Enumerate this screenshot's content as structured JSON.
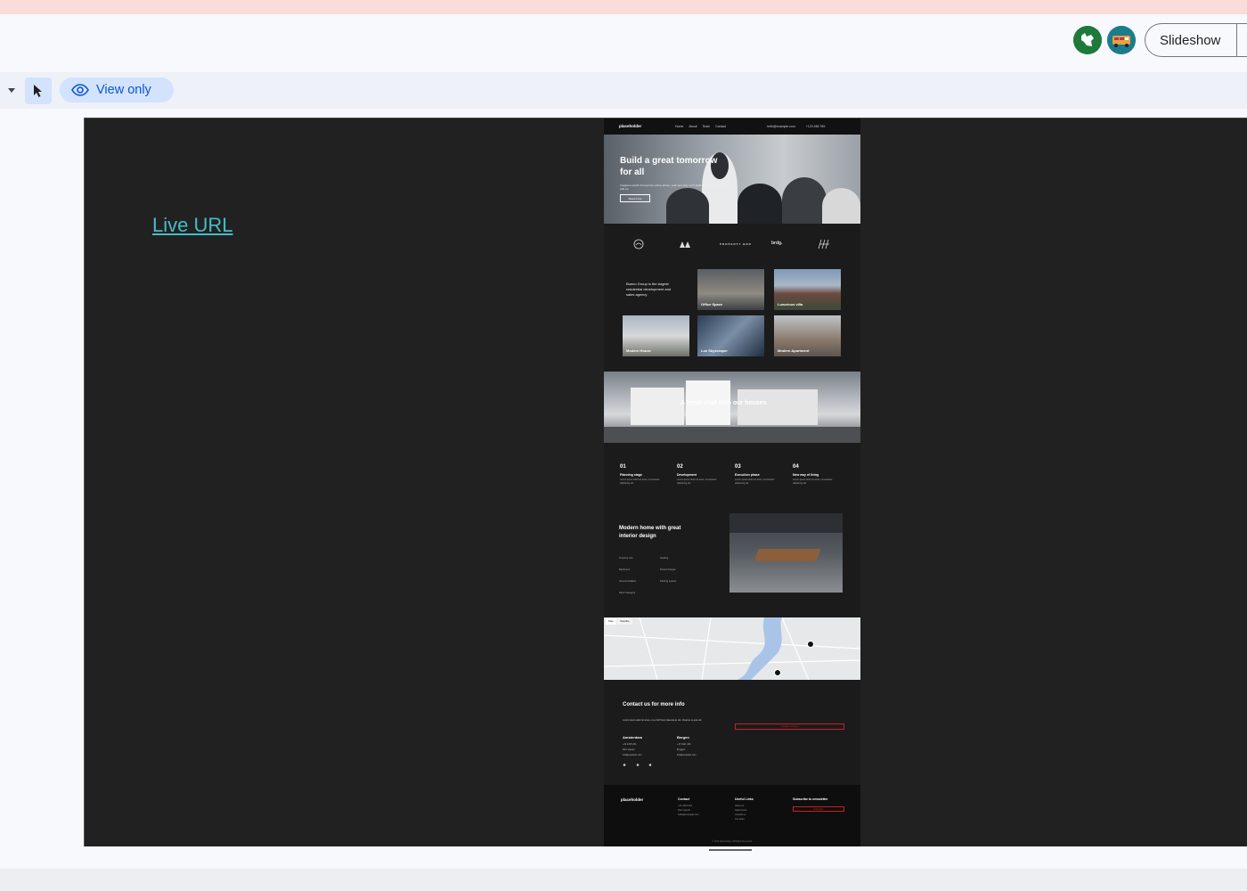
{
  "topbar": {
    "slideshow_label": "Slideshow"
  },
  "toolbar": {
    "mode_label": "View only"
  },
  "slide": {
    "link_label": "Live URL",
    "site": {
      "logo": "placeholder",
      "nav": [
        "Home",
        "About",
        "Team",
        "Contact"
      ],
      "email": "hello@example.com",
      "phone": "+123 456 789",
      "hero_title": "Build a great tomorrow for all",
      "hero_subtitle": "Imagine a world of tomorrow where all live, work and play. Let's build it together, and grow with us.",
      "hero_button": "Read more",
      "partner_logos": [
        "PROPERTY BRO",
        "brdg."
      ],
      "intro": "Bueno Group is the largest residential development and sales agency",
      "cards": [
        "Office Space",
        "Luxurious villa",
        "Modern House",
        "Lux Skyscraper",
        "Modern Apartment"
      ],
      "banner_text": "A fresh start with our houses",
      "steps": [
        {
          "num": "01",
          "title": "Planning stage",
          "text": "Lorem ipsum dolor sit amet, consectetur adipiscing elit."
        },
        {
          "num": "02",
          "title": "Development",
          "text": "Lorem ipsum dolor sit amet, consectetur adipiscing elit."
        },
        {
          "num": "03",
          "title": "Execution phase",
          "text": "Lorem ipsum dolor sit amet, consectetur adipiscing elit."
        },
        {
          "num": "04",
          "title": "New way of living",
          "text": "Lorem ipsum dolor sit amet, consectetur adipiscing elit."
        }
      ],
      "interior_title": "Modern home with great interior design",
      "specs_left": [
        "Property size",
        "Bedrooms",
        "Accommodation",
        "Rent/ Category"
      ],
      "specs_right": [
        "Heating",
        "Postal charges",
        "Parking spaces"
      ],
      "map_tabs": [
        "Map",
        "Satellite"
      ],
      "contact_title": "Contact us for more info",
      "contact_sub": "Lorem ipsum dolor sit amet, ut eu fuit! Nunc placerat ac dui. Vivamus ut quis elit.",
      "cities": [
        {
          "name": "Amsterdam",
          "lines": [
            "+31 2315 231",
            "Dam square",
            "info@example.com"
          ]
        },
        {
          "name": "Bergen",
          "lines": [
            "+47 3421 434",
            "Bryggen",
            "info@example.com"
          ]
        }
      ],
      "contact_button": "Contact us here",
      "footer_heads": [
        "Contact",
        "Useful Links",
        "Subscribe to newsletter"
      ],
      "footer_contact": [
        "+31 2315 231",
        "Dam square",
        "hello@example.com"
      ],
      "footer_links": [
        "About us",
        "Apartments",
        "Contact us",
        "Our team"
      ],
      "footer_subscribe": "Subscribe",
      "copyright": "© 2024 placeholder. All Rights Reserved."
    }
  }
}
